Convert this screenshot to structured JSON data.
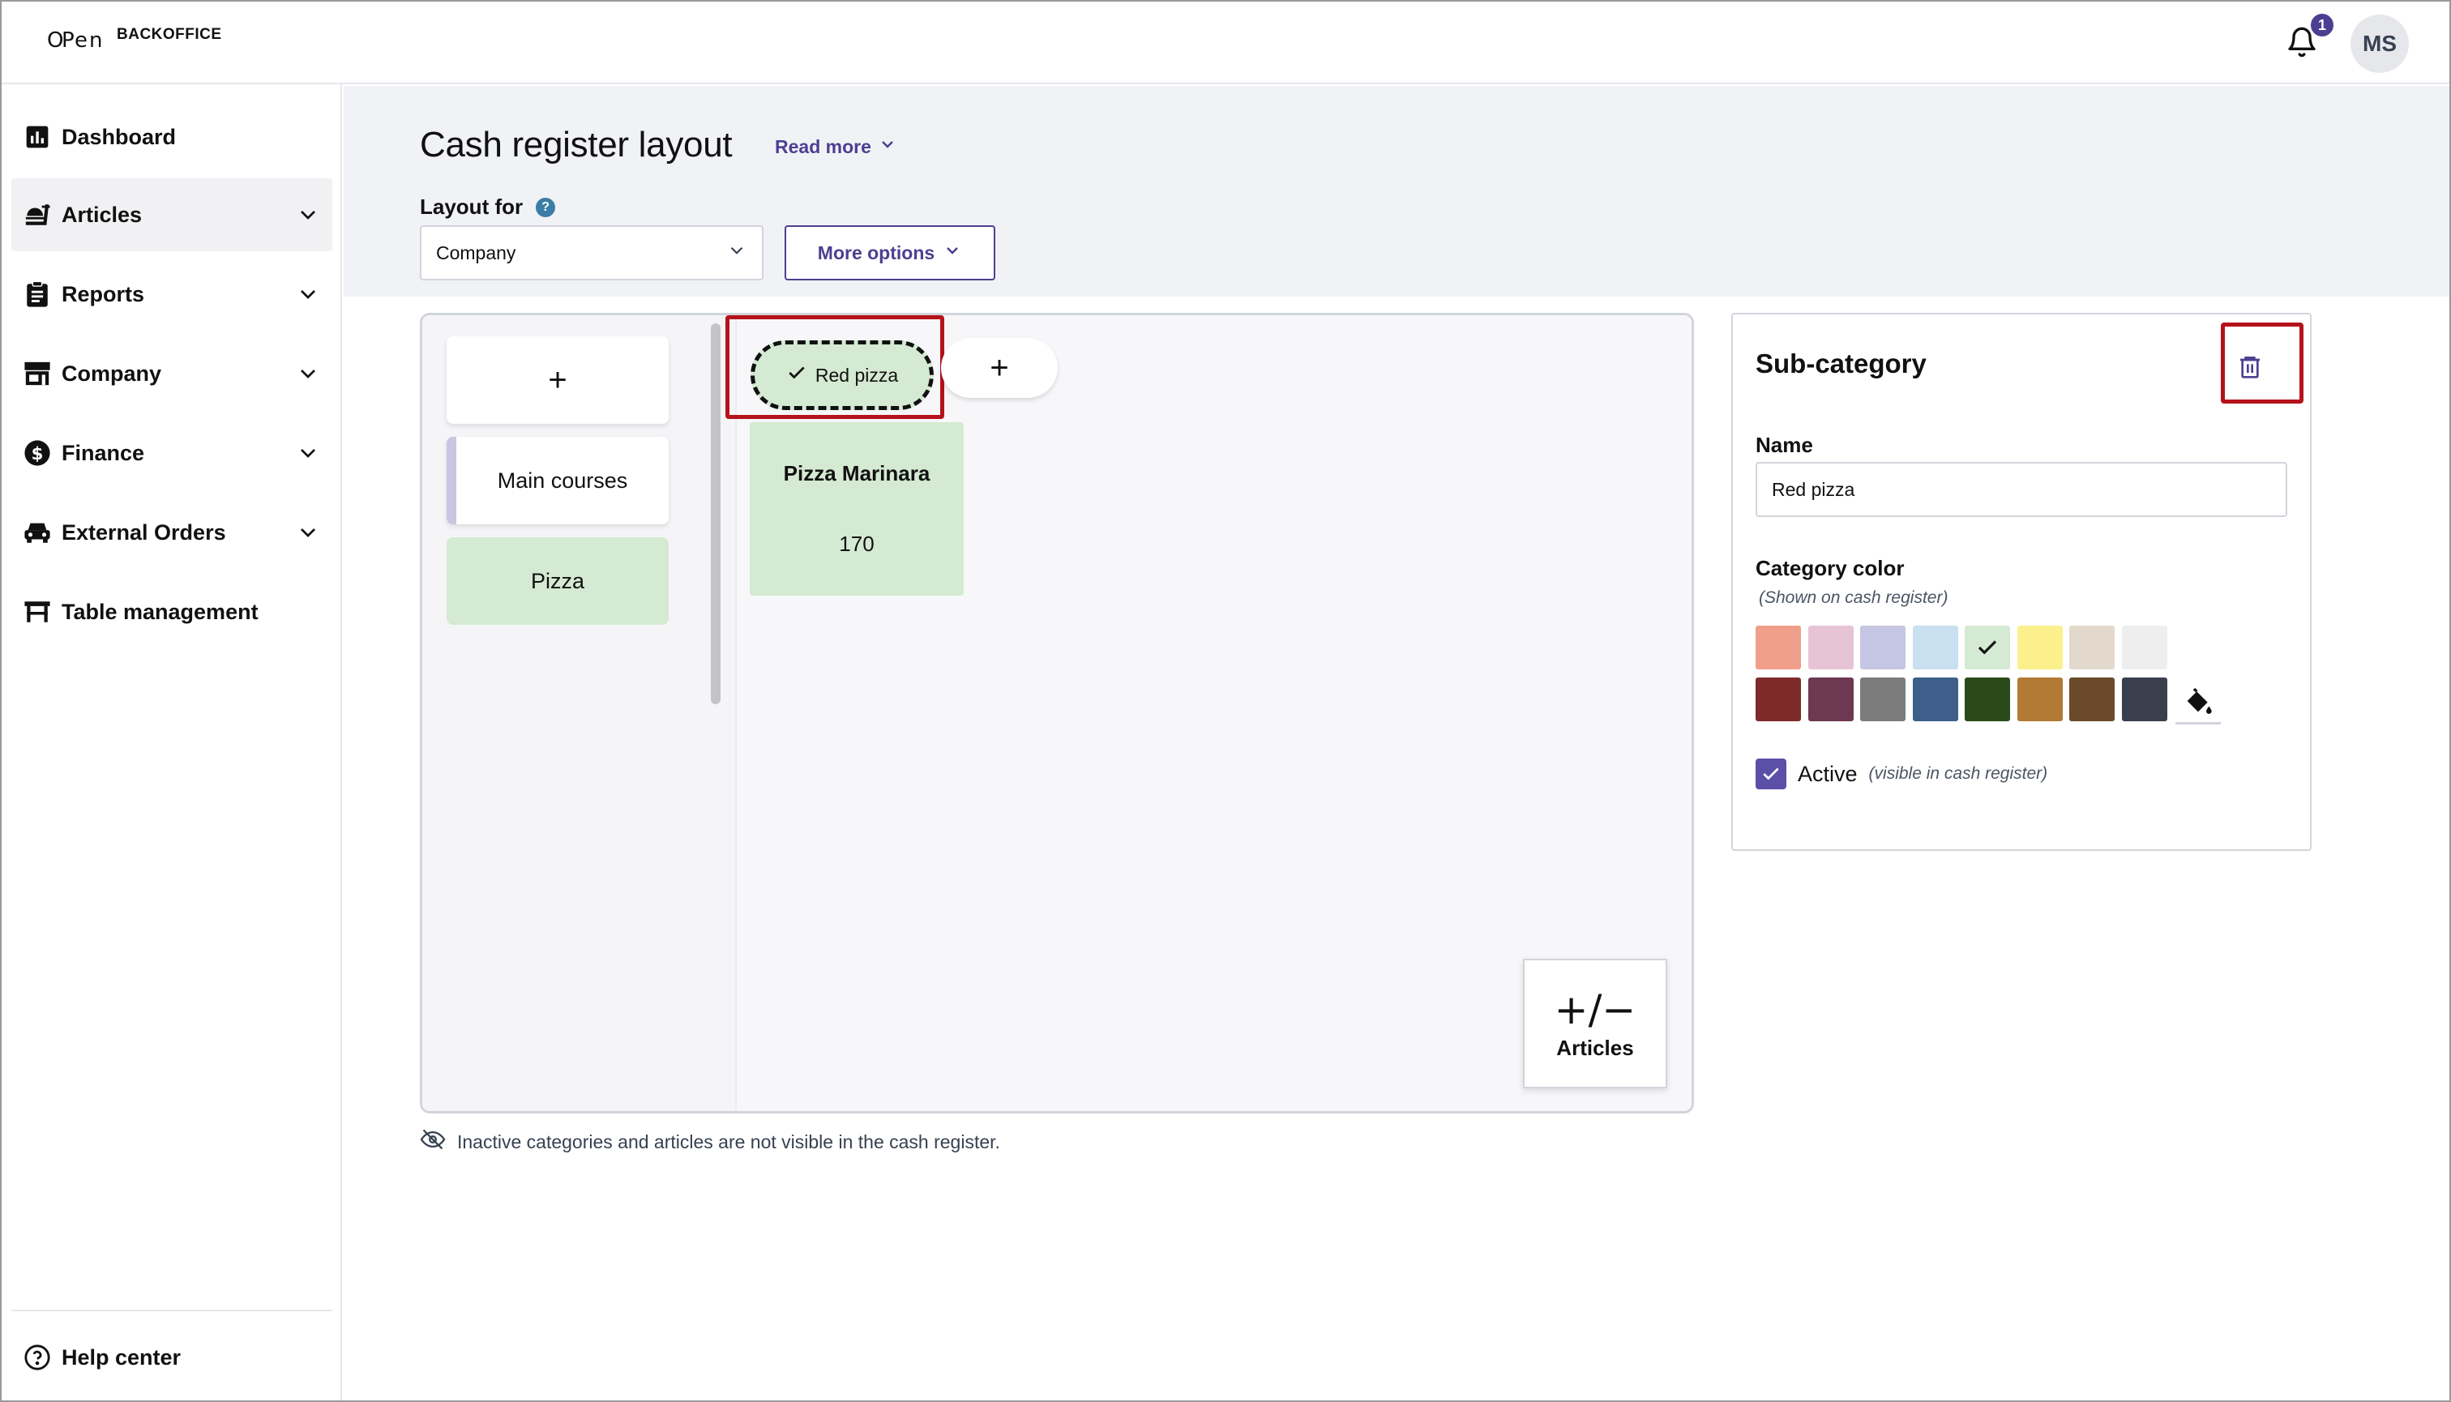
{
  "header": {
    "logo_mark": "OPEN",
    "logo_text": "BACKOFFICE",
    "notifications_count": "1",
    "user_initials": "MS"
  },
  "sidebar": {
    "items": [
      {
        "label": "Dashboard",
        "icon": "chart-icon"
      },
      {
        "label": "Articles",
        "icon": "articles-icon"
      },
      {
        "label": "Reports",
        "icon": "clipboard-icon"
      },
      {
        "label": "Company",
        "icon": "store-icon"
      },
      {
        "label": "Finance",
        "icon": "dollar-icon"
      },
      {
        "label": "External Orders",
        "icon": "car-icon"
      },
      {
        "label": "Table management",
        "icon": "table-icon"
      }
    ],
    "help_label": "Help center"
  },
  "page": {
    "title": "Cash register layout",
    "read_more": "Read more",
    "layout_for_label": "Layout for",
    "layout_for_value": "Company",
    "more_options": "More options"
  },
  "layout": {
    "categories": [
      {
        "label": "+"
      },
      {
        "label": "Main courses"
      },
      {
        "label": "Pizza"
      }
    ],
    "subcategory": "Red pizza",
    "add_subcategory": "+",
    "article": {
      "name": "Pizza Marinara",
      "price": "170"
    },
    "articles_button_symbol": "+/−",
    "articles_button_label": "Articles",
    "inactive_note": "Inactive categories and articles are not visible in the cash register."
  },
  "panel": {
    "title": "Sub-category",
    "name_label": "Name",
    "name_value": "Red pizza",
    "color_label": "Category color",
    "color_sub": "(Shown on cash register)",
    "colors_row1": [
      "#f0a08a",
      "#e7c3d6",
      "#c5c6e3",
      "#c8e0ef",
      "#d4ead2",
      "#fbf08c",
      "#e2d9cc",
      "#eeeeee"
    ],
    "colors_row2": [
      "#7e2a2a",
      "#6c3852",
      "#7b7b7b",
      "#3e5f8a",
      "#2a4a1a",
      "#b27a35",
      "#6a4a2a",
      "#3a3f4e"
    ],
    "selected_color_index": 4,
    "active_label": "Active",
    "active_hint": "(visible in cash register)",
    "active_checked": true
  },
  "colors": {
    "accent": "#4c3f91",
    "highlight_red": "#b5121b",
    "pizza_green": "#d4ead2"
  }
}
